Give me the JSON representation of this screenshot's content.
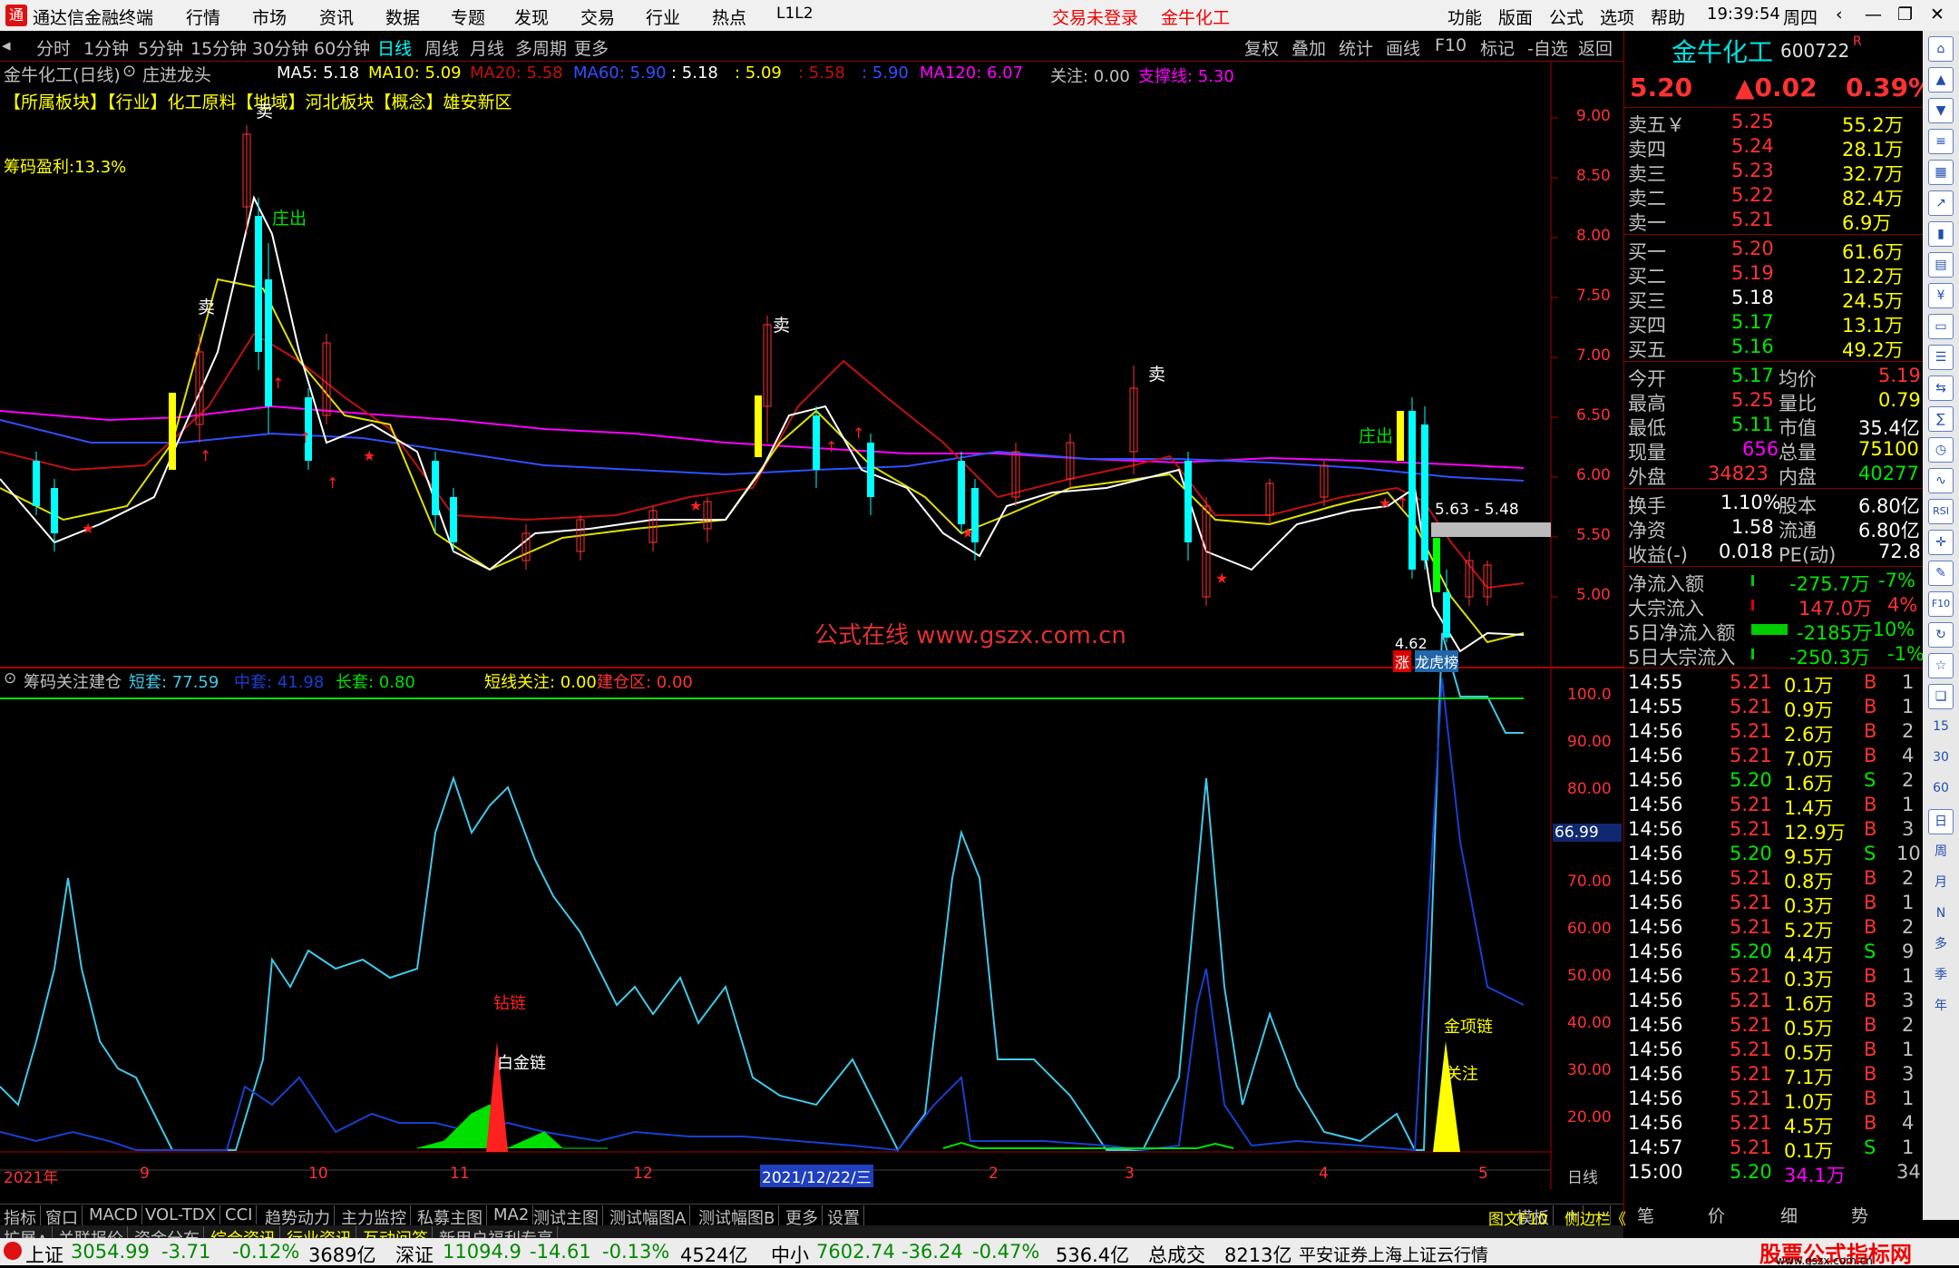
{
  "app": {
    "title": "通达信金融终端",
    "time": "19:39:54",
    "weekday": "周四",
    "login": "交易未登录",
    "stock_link": "金牛化工",
    "l1l2": "L1L2"
  },
  "menu": [
    "行情",
    "市场",
    "资讯",
    "数据",
    "专题",
    "发现",
    "交易",
    "行业",
    "热点"
  ],
  "menu_right": [
    "功能",
    "版面",
    "公式",
    "选项",
    "帮助"
  ],
  "periods": [
    "分时",
    "1分钟",
    "5分钟",
    "15分钟",
    "30分钟",
    "60分钟",
    "日线",
    "周线",
    "月线",
    "多周期",
    "更多"
  ],
  "tools": [
    "复权",
    "叠加",
    "统计",
    "画线",
    "F10",
    "标记",
    "-自选",
    "返回"
  ],
  "chart_title": "金牛化工(日线)",
  "chart_tag": "庄进龙头",
  "ma": {
    "ma5": "MA5: 5.18",
    "ma10": "MA10: 5.09",
    "ma20": "MA20: 5.58",
    "ma60": "MA60: 5.90",
    "v1": ": 5.18",
    "v2": ": 5.09",
    "v3": ": 5.58",
    "v4": ": 5.90",
    "ma120": "MA120: 6.07",
    "follow": "关注: 0.00",
    "support": "支撑线: 5.30"
  },
  "sectors": "【所属板块】【行业】化工原料【地域】河北板块【概念】雄安新区",
  "chip_profit": "筹码盈利:13.3%",
  "watermark": "公式在线 www.gszx.com.cn",
  "price_axis": [
    "9.00",
    "8.50",
    "8.00",
    "7.50",
    "7.00",
    "6.50",
    "6.00",
    "5.50",
    "5.00"
  ],
  "ind_axis": [
    "100.0",
    "90.00",
    "80.00",
    "70.00",
    "60.00",
    "50.00",
    "40.00",
    "30.00",
    "20.00"
  ],
  "ind_current": "66.99",
  "ind": {
    "name": "筹码关注建仓",
    "short": "短套: 77.59",
    "mid": "中套: 41.98",
    "long": "长套: 0.80",
    "focus": "短线关注: 0.00",
    "build": "建仓区: 0.00"
  },
  "labels": {
    "sell1": "卖",
    "sell2": "卖",
    "sell3": "卖",
    "sell4": "卖",
    "zc1": "庄出",
    "zc2": "庄出",
    "range": "5.63 - 5.48",
    "low": "4.62",
    "zhang": "涨",
    "bang": "龙虎榜",
    "diamond": "钻链",
    "platinum": "白金链",
    "gold": "金项链",
    "attn": "关注"
  },
  "date_axis": [
    "2021年",
    "9",
    "10",
    "11",
    "12",
    "2021/12/22/三",
    "2",
    "3",
    "4",
    "5"
  ],
  "date_period": "日线",
  "tabs": [
    "指标",
    "窗口",
    "MACD",
    "VOL-TDX",
    "CCI",
    "趋势动力",
    "主力监控",
    "私募主图",
    "MA2",
    "测试主图",
    "测试幅图A",
    "测试幅图B",
    "更多",
    "设置"
  ],
  "tabs_right": "模板",
  "tabs2": [
    "扩展∧",
    "关联报价",
    "资金分布",
    "综合资讯",
    "行业资讯",
    "互动问答",
    "新用户福利专享"
  ],
  "stock": {
    "name": "金牛化工",
    "code": "600722",
    "mark": "R",
    "price": "5.20",
    "change": "▲0.02",
    "pct": "0.39%"
  },
  "asks": [
    [
      "卖五￥",
      "5.25",
      "55.2万"
    ],
    [
      "卖四",
      "5.24",
      "28.1万"
    ],
    [
      "卖三",
      "5.23",
      "32.7万"
    ],
    [
      "卖二",
      "5.22",
      "82.4万"
    ],
    [
      "卖一",
      "5.21",
      "6.9万"
    ]
  ],
  "bids": [
    [
      "买一",
      "5.20",
      "61.6万"
    ],
    [
      "买二",
      "5.19",
      "12.2万"
    ],
    [
      "买三",
      "5.18",
      "24.5万"
    ],
    [
      "买四",
      "5.17",
      "13.1万"
    ],
    [
      "买五",
      "5.16",
      "49.2万"
    ]
  ],
  "stats": [
    [
      "今开",
      "5.17",
      "均价",
      "5.19"
    ],
    [
      "最高",
      "5.25",
      "量比",
      "0.79"
    ],
    [
      "最低",
      "5.11",
      "市值",
      "35.4亿"
    ],
    [
      "现量",
      "656",
      "总量",
      "75100"
    ],
    [
      "外盘",
      "34823",
      "内盘",
      "40277"
    ]
  ],
  "stats2": [
    [
      "换手",
      "1.10%",
      "股本",
      "6.80亿"
    ],
    [
      "净资",
      "1.58",
      "流通",
      "6.80亿"
    ],
    [
      "收益(-)",
      "0.018",
      "PE(动)",
      "72.8"
    ]
  ],
  "flows": [
    [
      "净流入额",
      "-275.7万",
      "-7%"
    ],
    [
      "大宗流入",
      "147.0万",
      "4%"
    ],
    [
      "5日净流入额",
      "-2185万",
      "-10%"
    ],
    [
      "5日大宗流入",
      "-250.3万",
      "-1%"
    ]
  ],
  "ticks": [
    [
      "14:55",
      "5.21",
      "0.1万",
      "B",
      "1"
    ],
    [
      "14:55",
      "5.21",
      "0.9万",
      "B",
      "1"
    ],
    [
      "14:56",
      "5.21",
      "2.6万",
      "B",
      "2"
    ],
    [
      "14:56",
      "5.21",
      "7.0万",
      "B",
      "4"
    ],
    [
      "14:56",
      "5.20",
      "1.6万",
      "S",
      "2"
    ],
    [
      "14:56",
      "5.21",
      "1.4万",
      "B",
      "1"
    ],
    [
      "14:56",
      "5.21",
      "12.9万",
      "B",
      "3"
    ],
    [
      "14:56",
      "5.20",
      "9.5万",
      "S",
      "10"
    ],
    [
      "14:56",
      "5.21",
      "0.8万",
      "B",
      "2"
    ],
    [
      "14:56",
      "5.21",
      "0.3万",
      "B",
      "1"
    ],
    [
      "14:56",
      "5.21",
      "5.2万",
      "B",
      "2"
    ],
    [
      "14:56",
      "5.20",
      "4.4万",
      "S",
      "9"
    ],
    [
      "14:56",
      "5.21",
      "0.3万",
      "B",
      "1"
    ],
    [
      "14:56",
      "5.21",
      "1.6万",
      "B",
      "3"
    ],
    [
      "14:56",
      "5.21",
      "0.5万",
      "B",
      "2"
    ],
    [
      "14:56",
      "5.21",
      "0.5万",
      "B",
      "1"
    ],
    [
      "14:56",
      "5.21",
      "7.1万",
      "B",
      "3"
    ],
    [
      "14:56",
      "5.21",
      "1.0万",
      "B",
      "1"
    ],
    [
      "14:56",
      "5.21",
      "4.5万",
      "B",
      "4"
    ],
    [
      "14:57",
      "5.21",
      "0.1万",
      "S",
      "1"
    ],
    [
      "15:00",
      "5.20",
      "34.1万",
      "",
      "34"
    ]
  ],
  "rp_bottom": {
    "f10": "图文F10",
    "sidebar": "侧边栏《",
    "tabs": [
      "笔",
      "价",
      "细",
      "势"
    ]
  },
  "side_icons": [
    "日",
    "周",
    "月",
    "N",
    "多",
    "季",
    "年"
  ],
  "side_letters": [
    "RSI",
    "F10",
    "15",
    "30",
    "60"
  ],
  "index": {
    "sh": "上证",
    "sh_v": "3054.99",
    "sh_c": "-3.71",
    "sh_p": "-0.12%",
    "sh_a": "3689亿",
    "sz": "深证",
    "sz_v": "11094.9",
    "sz_c": "-14.61",
    "sz_p": "-0.13%",
    "sz_a": "4524亿",
    "zx": "中小",
    "zx_v": "7602.74",
    "zx_c": "-36.24",
    "zx_p": "-0.47%",
    "zx_a": "536.4亿",
    "total": "总成交",
    "total_v": "8213亿",
    "broker": "平安证券上海上证云行情"
  },
  "brand": "股票公式指标网",
  "brand_url": "www.gszx.com.cn",
  "chart_data": {
    "type": "line",
    "series": [
      {
        "name": "短套",
        "values": [
          28,
          61,
          28,
          18,
          0,
          0,
          61,
          40,
          80,
          82,
          79,
          60,
          45,
          40,
          38,
          18,
          8,
          60,
          70,
          38,
          13,
          52,
          18,
          18,
          84,
          40,
          28,
          40,
          0,
          97,
          88,
          78
        ]
      },
      {
        "name": "中套",
        "values": [
          3,
          5,
          5,
          2,
          0,
          0,
          30,
          22,
          15,
          14,
          12,
          8,
          7,
          6,
          5,
          4,
          3,
          4,
          30,
          4,
          3,
          4,
          6,
          3,
          45,
          8,
          4,
          3,
          0,
          90,
          60,
          40
        ]
      }
    ],
    "ylim": [
      0,
      100
    ]
  }
}
